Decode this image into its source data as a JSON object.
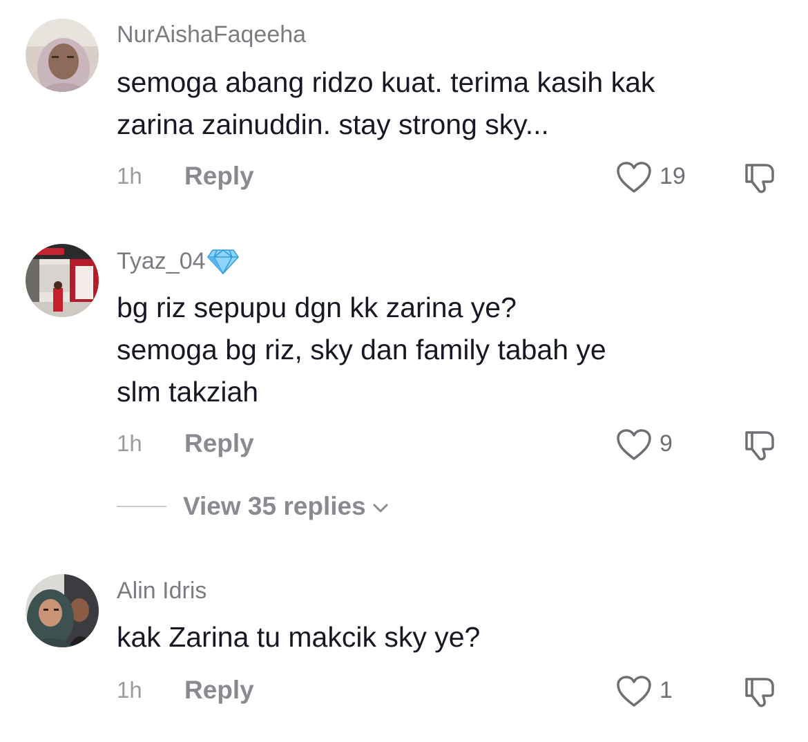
{
  "comments": [
    {
      "username": "NurAishaFaqeeha",
      "text": "semoga abang ridzo kuat. terima kasih kak\nzarina zainuddin. stay strong sky...",
      "time": "1h",
      "reply_label": "Reply",
      "likes": "19"
    },
    {
      "username": "Tyaz_04",
      "badge": "gem-icon",
      "text": "bg riz sepupu dgn kk zarina ye?\nsemoga bg riz, sky dan family tabah ye\nslm takziah",
      "time": "1h",
      "reply_label": "Reply",
      "likes": "9",
      "view_replies": "View 35 replies"
    },
    {
      "username": "Alin Idris",
      "text": "kak Zarina tu makcik sky ye?",
      "time": "1h",
      "reply_label": "Reply",
      "likes": "1"
    }
  ],
  "colors": {
    "username": "#7b7c82",
    "text": "#161823",
    "meta": "#9a9ba0",
    "reply": "#8a8b91",
    "badge": "#5ab8f0"
  }
}
